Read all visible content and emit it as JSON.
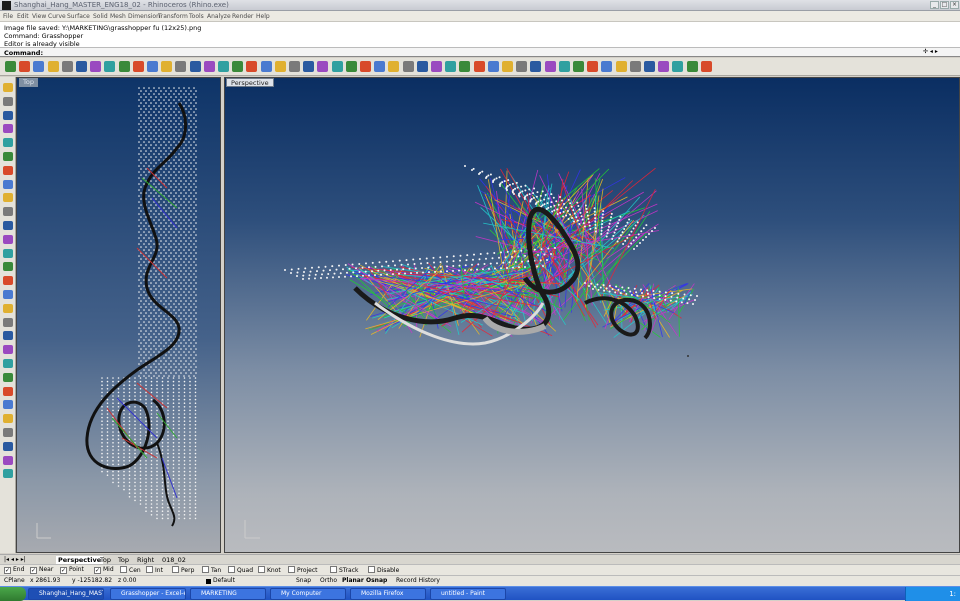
{
  "window": {
    "title": "Shanghai_Hang_MASTER_ENG18_02 - Rhinoceros (Rhino.exe)"
  },
  "menu": [
    "File",
    "Edit",
    "View",
    "Curve",
    "Surface",
    "Solid",
    "Mesh",
    "Dimension",
    "Transform",
    "Tools",
    "Analyze",
    "Render",
    "Help"
  ],
  "command_history": [
    "Image file saved: Y:\\MARKETING\\grasshopper fu (12x25).png",
    "Command: Grasshopper",
    "Editor is already visible"
  ],
  "command_prompt": "Command:",
  "viewports": {
    "left_label": "Top",
    "main_label": "Perspective"
  },
  "viewport_tabs": [
    "Perspective",
    "Top",
    "Top",
    "Right",
    "018_02"
  ],
  "osnaps": [
    {
      "label": "End",
      "checked": true
    },
    {
      "label": "Near",
      "checked": true
    },
    {
      "label": "Point",
      "checked": true
    },
    {
      "label": "Mid",
      "checked": true
    },
    {
      "label": "Cen",
      "checked": false
    },
    {
      "label": "Int",
      "checked": false
    },
    {
      "label": "Perp",
      "checked": false
    },
    {
      "label": "Tan",
      "checked": false
    },
    {
      "label": "Quad",
      "checked": false
    },
    {
      "label": "Knot",
      "checked": false
    },
    {
      "label": "Project",
      "checked": false
    },
    {
      "label": "STrack",
      "checked": false
    },
    {
      "label": "Disable",
      "checked": false
    }
  ],
  "status": {
    "cplane": "CPlane",
    "x": "x 2861.93",
    "y": "y -125182.82",
    "z": "z 0.00",
    "layer": "Default",
    "toggles": [
      "Snap",
      "Ortho",
      "Planar",
      "Osnap",
      "Record History"
    ]
  },
  "taskbar": {
    "tasks": [
      "Shanghai_Hang_MAST...",
      "Grasshopper - Excel-e...",
      "MARKETING",
      "My Computer",
      "Mozilla Firefox",
      "untitled - Paint"
    ],
    "clock": "1:"
  },
  "colors": {
    "desktop": "#d4d0c8",
    "viewport_top": "#0a2e62",
    "viewport_bottom": "#b9bbbf",
    "taskbar": "#2052c3"
  },
  "toolbar_icons": [
    "viewport-icon",
    "run-icon",
    "stop-icon",
    "play-icon",
    "step-back-icon",
    "step-icon",
    "step-forward-icon",
    "end-icon",
    "new-icon",
    "open-icon",
    "save-icon",
    "print-icon",
    "cut-icon",
    "copy-icon",
    "paste-icon",
    "undo-icon",
    "pan-icon",
    "rotate-icon",
    "zoom-icon",
    "zoom-window-icon",
    "zoom-extents-icon",
    "zoom-selected-icon",
    "undo-view-icon",
    "four-view-icon",
    "grid-icon",
    "car-icon",
    "object-properties-icon",
    "layer-icon",
    "light-icon",
    "lock-icon",
    "shaded-icon",
    "render-icon",
    "rendered-icon",
    "sphere-icon",
    "wireframe-icon",
    "ghosted-icon",
    "sun-icon",
    "gear-icon",
    "stack-icon",
    "help-icon",
    "arrow-left-icon",
    "arrow-up-icon",
    "arrow-rotate-icon",
    "arrow-right-icon",
    "move-icon",
    "orient-icon",
    "align-icon",
    "mirror-icon",
    "grab-icon",
    "snap-icon"
  ]
}
